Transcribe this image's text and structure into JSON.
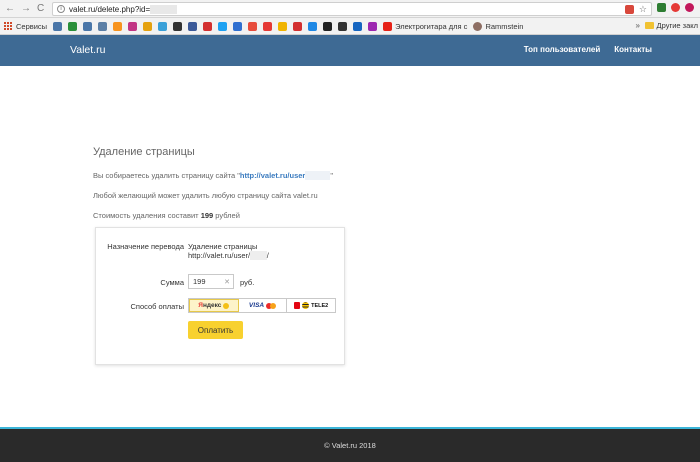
{
  "browser": {
    "url": "valet.ru/delete.php?id=",
    "url_hidden": "            ",
    "nav_back": "←",
    "nav_forward": "→",
    "nav_reload": "C",
    "star": "☆"
  },
  "bookmarks": {
    "apps_label": "Сервисы",
    "items": [
      {
        "icon": "vk-icon",
        "color": "#4a76a8"
      },
      {
        "icon": "bookmark-icon",
        "color": "#2a8f3a"
      },
      {
        "icon": "vk-icon",
        "color": "#4a76a8"
      },
      {
        "icon": "vk-icon",
        "color": "#5b7fa6"
      },
      {
        "icon": "ok-icon",
        "color": "#f7931e"
      },
      {
        "icon": "instagram-icon",
        "color": "#c13584"
      },
      {
        "icon": "bookmark-icon",
        "color": "#e5a20f"
      },
      {
        "icon": "drop-icon",
        "color": "#3aa0d8"
      },
      {
        "icon": "bookmark-icon",
        "color": "#333333"
      },
      {
        "icon": "bookmark-icon",
        "color": "#3b5998"
      },
      {
        "icon": "e1-icon",
        "color": "#d32f2f"
      },
      {
        "icon": "bookmark-icon",
        "color": "#1da1f2"
      },
      {
        "icon": "bookmark-icon",
        "color": "#2f6fd0"
      },
      {
        "icon": "bookmark-icon",
        "color": "#e74c3c"
      },
      {
        "icon": "bookmark-icon",
        "color": "#e53935"
      },
      {
        "icon": "bookmark-icon",
        "color": "#f0b400"
      },
      {
        "icon": "avito-icon",
        "color": "#d32f2f"
      },
      {
        "icon": "cart-icon",
        "color": "#1e88e5"
      },
      {
        "icon": "note-icon",
        "color": "#222222"
      },
      {
        "icon": "tools-icon",
        "color": "#333333"
      },
      {
        "icon": "bookmark-icon",
        "color": "#1565c0"
      },
      {
        "icon": "bookmark-icon",
        "color": "#9c27b0"
      }
    ],
    "youtube_label": "Электрогитара для с",
    "rammstein_label": "Rammstein",
    "more": "»",
    "other_label": "Другие закл"
  },
  "header": {
    "brand": "Valet.ru",
    "nav": [
      "Топ пользователей",
      "Контакты"
    ]
  },
  "content": {
    "title": "Удаление страницы",
    "p1_prefix": "Вы собираетесь удалить страницу сайта \"",
    "p1_link": "http://valet.ru/user",
    "p1_hidden": "            ",
    "p1_suffix": "\"",
    "p2": "Любой желающий может удалить любую страницу сайта valet.ru",
    "p3_prefix": "Стоимость удаления составит ",
    "p3_amount": "199",
    "p3_suffix": " рублей"
  },
  "payment": {
    "purpose_label": "Назначение перевода",
    "purpose_line1": "Удаление страницы",
    "purpose_line2": "http://valet.ru/user/",
    "purpose_hidden": "        ",
    "purpose_tail": "/",
    "amount_label": "Сумма",
    "amount_value": "199",
    "amount_clear": "✕",
    "currency": "руб.",
    "method_label": "Способ оплаты",
    "methods": {
      "yandex_ya": "Я",
      "yandex_rest": "ндекс",
      "visa": "VISA",
      "tele2": "TELE2"
    },
    "submit": "Оплатить"
  },
  "footer": {
    "copyright": "© Valet.ru 2018"
  }
}
